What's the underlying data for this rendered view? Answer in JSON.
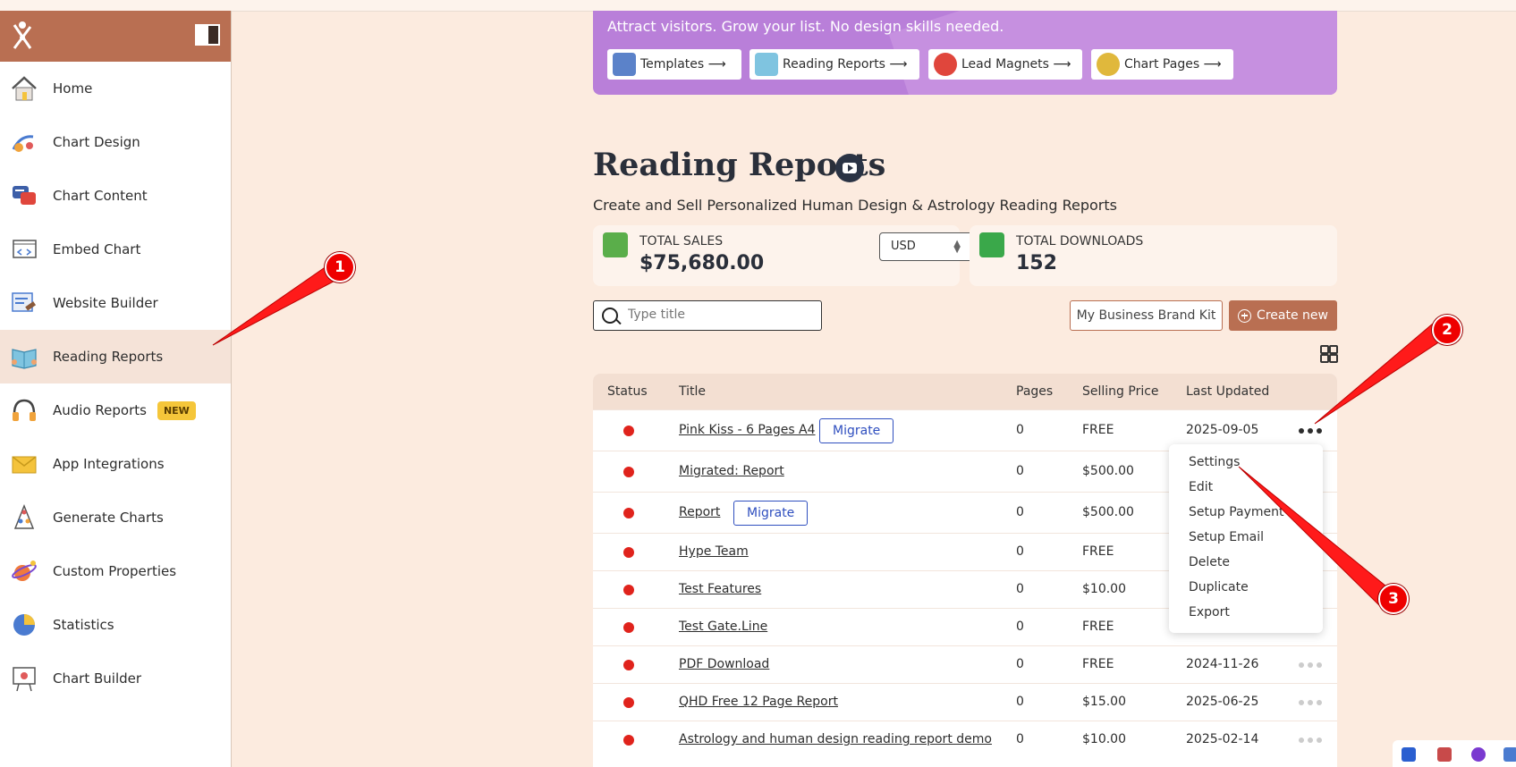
{
  "sidebar": {
    "items": [
      {
        "label": "Home",
        "icon": "home-icon"
      },
      {
        "label": "Chart Design",
        "icon": "chart-design-icon"
      },
      {
        "label": "Chart Content",
        "icon": "chart-content-icon"
      },
      {
        "label": "Embed Chart",
        "icon": "embed-chart-icon"
      },
      {
        "label": "Website Builder",
        "icon": "website-builder-icon"
      },
      {
        "label": "Reading Reports",
        "icon": "reading-reports-icon",
        "active": true
      },
      {
        "label": "Audio Reports",
        "icon": "audio-reports-icon",
        "badge": "NEW"
      },
      {
        "label": "App Integrations",
        "icon": "app-integrations-icon"
      },
      {
        "label": "Generate Charts",
        "icon": "generate-charts-icon"
      },
      {
        "label": "Custom Properties",
        "icon": "custom-properties-icon"
      },
      {
        "label": "Statistics",
        "icon": "statistics-icon"
      },
      {
        "label": "Chart Builder",
        "icon": "chart-builder-icon"
      }
    ]
  },
  "banner": {
    "subtitle": "Attract visitors. Grow your list. No design skills needed.",
    "buttons": [
      {
        "label": "Templates ⟶",
        "icon": "templates-icon"
      },
      {
        "label": "Reading Reports ⟶",
        "icon": "reading-reports-icon"
      },
      {
        "label": "Lead Magnets ⟶",
        "icon": "magnet-icon"
      },
      {
        "label": "Chart Pages ⟶",
        "icon": "chart-pages-icon"
      }
    ]
  },
  "page": {
    "title": "Reading Reports",
    "description": "Create and Sell Personalized Human Design & Astrology Reading Reports"
  },
  "stats": {
    "sales_label": "TOTAL SALES",
    "sales_value": "$75,680.00",
    "currency": "USD",
    "downloads_label": "TOTAL DOWNLOADS",
    "downloads_value": "152"
  },
  "toolbar": {
    "search_placeholder": "Type title",
    "brand_kit_label": "My Business Brand Kit",
    "create_label": "Create new"
  },
  "table": {
    "headers": {
      "status": "Status",
      "title": "Title",
      "pages": "Pages",
      "price": "Selling Price",
      "updated": "Last Updated"
    },
    "migrate_label": "Migrate",
    "rows": [
      {
        "title": "Pink Kiss - 6 Pages A4",
        "pages": "0",
        "price": "FREE",
        "updated": "2025-09-05",
        "migrate": true
      },
      {
        "title": "Migrated: Report",
        "pages": "0",
        "price": "$500.00",
        "updated": ""
      },
      {
        "title": "Report",
        "pages": "0",
        "price": "$500.00",
        "updated": "",
        "migrate": true
      },
      {
        "title": "Hype Team",
        "pages": "0",
        "price": "FREE",
        "updated": ""
      },
      {
        "title": "Test Features",
        "pages": "0",
        "price": "$10.00",
        "updated": ""
      },
      {
        "title": "Test Gate.Line",
        "pages": "0",
        "price": "FREE",
        "updated": ""
      },
      {
        "title": "PDF Download",
        "pages": "0",
        "price": "FREE",
        "updated": "2024-11-26"
      },
      {
        "title": "QHD Free 12 Page Report",
        "pages": "0",
        "price": "$15.00",
        "updated": "2025-06-25"
      },
      {
        "title": "Astrology and human design reading report demo",
        "pages": "0",
        "price": "$10.00",
        "updated": "2025-02-14"
      }
    ]
  },
  "menu": {
    "items": [
      "Settings",
      "Edit",
      "Setup Payment",
      "Setup Email",
      "Delete",
      "Duplicate",
      "Export"
    ]
  },
  "annotations": [
    "1",
    "2",
    "3"
  ],
  "colors": {
    "brand": "#b96f52",
    "background": "#fcebdf",
    "status_dot": "#e0231c",
    "banner": "#b97fd9",
    "annotation": "#ee0000"
  }
}
